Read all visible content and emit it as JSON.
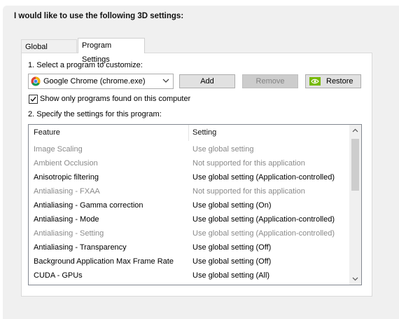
{
  "heading": "I would like to use the following 3D settings:",
  "tabs": [
    {
      "label": "Global Settings",
      "active": false
    },
    {
      "label": "Program Settings",
      "active": true
    }
  ],
  "step1_label": "1. Select a program to customize:",
  "program_select": {
    "value": "Google Chrome (chrome.exe)",
    "icon": "chrome-icon"
  },
  "buttons": {
    "add": "Add",
    "remove": "Remove",
    "restore": "Restore"
  },
  "checkbox": {
    "label": "Show only programs found on this computer",
    "checked": true
  },
  "step2_label": "2. Specify the settings for this program:",
  "table": {
    "headers": {
      "feature": "Feature",
      "setting": "Setting"
    },
    "rows": [
      {
        "feature": "Image Scaling",
        "setting": "Use global setting",
        "dim": true
      },
      {
        "feature": "Ambient Occlusion",
        "setting": "Not supported for this application",
        "dim": true
      },
      {
        "feature": "Anisotropic filtering",
        "setting": "Use global setting (Application-controlled)",
        "dim": false
      },
      {
        "feature": "Antialiasing - FXAA",
        "setting": "Not supported for this application",
        "dim": true
      },
      {
        "feature": "Antialiasing - Gamma correction",
        "setting": "Use global setting (On)",
        "dim": false
      },
      {
        "feature": "Antialiasing - Mode",
        "setting": "Use global setting (Application-controlled)",
        "dim": false
      },
      {
        "feature": "Antialiasing - Setting",
        "setting": "Use global setting (Application-controlled)",
        "dim": true
      },
      {
        "feature": "Antialiasing - Transparency",
        "setting": "Use global setting (Off)",
        "dim": false
      },
      {
        "feature": "Background Application Max Frame Rate",
        "setting": "Use global setting (Off)",
        "dim": false
      },
      {
        "feature": "CUDA - GPUs",
        "setting": "Use global setting (All)",
        "dim": false
      }
    ]
  },
  "colors": {
    "nvidia_green": "#76b900",
    "dim_text": "#8a8a8a"
  }
}
